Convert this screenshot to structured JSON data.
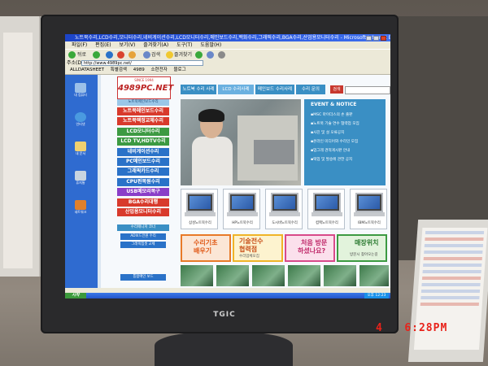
{
  "photo": {
    "timestamp_day": "4",
    "timestamp_time": "6:28PM",
    "monitor_brand": "TGIC"
  },
  "browser": {
    "window_title": "노트북수리,LCD수리,모니터수리,네비게이션수리,LCD모니터수리,메인보드수리,백화수리,그래픽수리,BGA수리,산업용모니터수리 - Microsoft Internet Explorer",
    "menu": [
      "파일(F)",
      "편집(E)",
      "보기(V)",
      "즐겨찾기(A)",
      "도구(T)",
      "도움말(H)"
    ],
    "toolbar": {
      "back": "뒤로",
      "search": "검색",
      "favorites": "즐겨찾기"
    },
    "address_label": "주소(D)",
    "address": "http://www.4989pc.net/",
    "links": [
      "ALLDATASHEET",
      "특별검색",
      "4989",
      "소련전자",
      "블로그"
    ]
  },
  "site": {
    "logo_since": "SINCE 1994",
    "logo": "4989PC.NET",
    "menu_top": "노트북메인보드수리",
    "categories": [
      {
        "label": "노트북메인보드수리",
        "color": "#d83a2c"
      },
      {
        "label": "노트북액정교체수리",
        "color": "#d83a2c"
      },
      {
        "label": "LCD모니터수리",
        "color": "#3c9a42"
      },
      {
        "label": "LCD TV,HDTV수리",
        "color": "#3c9a42"
      },
      {
        "label": "네비게이션수리",
        "color": "#2a72c8"
      },
      {
        "label": "PC메인보드수리",
        "color": "#2a72c8"
      },
      {
        "label": "그래픽카드수리",
        "color": "#2a72c8"
      },
      {
        "label": "CPU핀복원수리",
        "color": "#2a72c8"
      },
      {
        "label": "USB메모리복구",
        "color": "#8a3ec8"
      },
      {
        "label": "BGA수리대행",
        "color": "#d83a2c"
      },
      {
        "label": "산업용모니터수리",
        "color": "#d83a2c"
      }
    ],
    "sub_menu_title": "수리매니저 코너",
    "sub_menu": [
      "AD보드전원 수리",
      "그래픽칩셋 교체",
      "통합메인 보드"
    ],
    "tabs": [
      "노트북 수리 사례",
      "LCD 수리사례",
      "메인보드 수리사례",
      "수리 문의"
    ],
    "search_button": "검색",
    "event_title": "EVENT & NOTICE",
    "events": [
      "MSC 마이더스의 손 출판",
      "노트북 기술 연수 협력업 모집",
      "사진 및 설 오류공지",
      "온라인 미디어와 수리인 모집",
      "업그레 견적게시판 안내",
      "택업 및 발송에 관한 공지"
    ],
    "thumbnails": [
      "삼성노트북수리",
      "HP노트북수리",
      "도시바노트북수리",
      "컴팩노트북수리",
      "IBM노트북수리"
    ],
    "banners": [
      {
        "big": "수리기초",
        "big2": "배우기",
        "color": "#e87a28"
      },
      {
        "big": "기술전수",
        "big2": "협력점",
        "small": "수리업체모집",
        "color": "#f0b428"
      },
      {
        "big": "처음 방문",
        "big2": "하셨나요?",
        "color": "#d84a8a"
      },
      {
        "big": "매장위치",
        "small": "방문시 찾아오는길",
        "color": "#3c9a42"
      }
    ]
  },
  "desktop_icons": [
    "내 컴퓨터",
    "인터넷",
    "내 문서",
    "휴지통",
    "네트워크"
  ],
  "taskbar": {
    "start": "시작",
    "clock": "오후 12:23"
  }
}
